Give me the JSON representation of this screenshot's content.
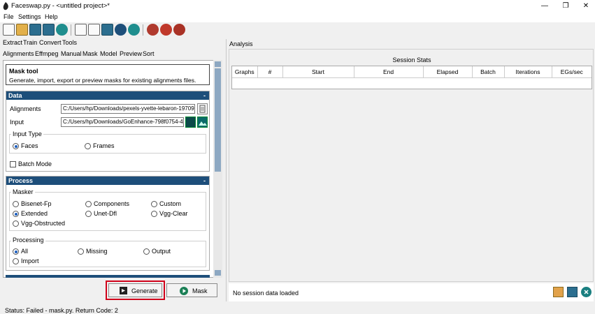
{
  "window": {
    "title": "Faceswap.py - <untitled project>*",
    "minimize": "—",
    "maximize": "❐",
    "close": "✕"
  },
  "menu": [
    "File",
    "Settings",
    "Help"
  ],
  "top_tabs": [
    "Extract",
    "Train",
    "Convert",
    "Tools"
  ],
  "sub_tabs": [
    "Alignments",
    "Effmpeg",
    "Manual",
    "Mask",
    "Model",
    "Preview",
    "Sort"
  ],
  "mask_tool": {
    "title": "Mask tool",
    "description": "Generate, import, export or preview masks for existing alignments files."
  },
  "data_section": {
    "header": "Data",
    "alignments_label": "Alignments",
    "alignments_value": "C:/Users/hp/Downloads/pexels-yvette-lebaron-19709",
    "input_label": "Input",
    "input_value": "C:/Users/hp/Downloads/GoEnhance-798f0754-4",
    "input_type_label": "Input Type",
    "faces": "Faces",
    "frames": "Frames",
    "batch_mode": "Batch Mode"
  },
  "process_section": {
    "header": "Process",
    "masker_label": "Masker",
    "maskers": [
      "Bisenet-Fp",
      "Components",
      "Custom",
      "Extended",
      "Unet-Dfl",
      "Vgg-Clear",
      "Vgg-Obstructed"
    ],
    "processing_label": "Processing",
    "processing": [
      "All",
      "Missing",
      "Output",
      "Import"
    ]
  },
  "collapse": "-",
  "buttons": {
    "generate": "Generate",
    "mask": "Mask"
  },
  "analysis": {
    "tab": "Analysis",
    "session_stats": "Session Stats",
    "columns": [
      "Graphs",
      "#",
      "Start",
      "End",
      "Elapsed",
      "Batch",
      "Iterations",
      "EGs/sec"
    ],
    "no_session": "No session data loaded"
  },
  "status": "Status:  Failed - mask.py. Return Code: 2",
  "colors": {
    "header": "#1d4e7a",
    "highlight": "#d0021b",
    "accent": "#1d5fbf"
  }
}
